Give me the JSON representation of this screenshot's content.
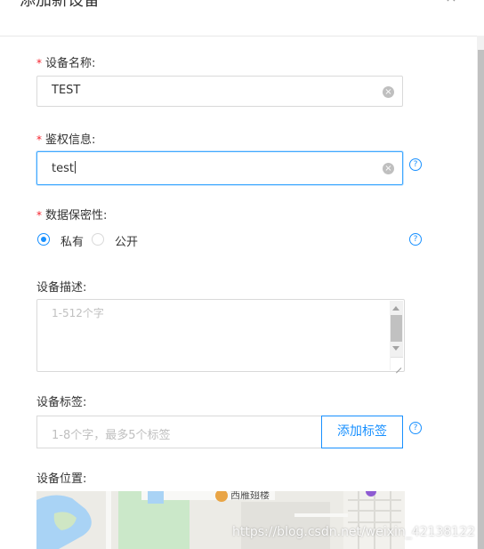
{
  "dialog": {
    "title": "添加新设备",
    "close_glyph": "×"
  },
  "form": {
    "device_name": {
      "required_mark": "*",
      "label": "设备名称:",
      "value": "TEST"
    },
    "auth_info": {
      "required_mark": "*",
      "label": "鉴权信息:",
      "value": "test"
    },
    "data_privacy": {
      "required_mark": "*",
      "label": "数据保密性:",
      "options": [
        {
          "label": "私有",
          "checked": true
        },
        {
          "label": "公开",
          "checked": false
        }
      ]
    },
    "description": {
      "label": "设备描述:",
      "placeholder": "1-512个字"
    },
    "tags": {
      "label": "设备标签:",
      "placeholder": "1-8个字，最多5个标签",
      "add_button": "添加标签"
    },
    "location": {
      "label": "设备位置:",
      "map_place_label": "西雁翅楼"
    }
  },
  "icons": {
    "clear": "×",
    "help": "?"
  },
  "colors": {
    "primary": "#1890ff",
    "required": "#f5222d",
    "placeholder": "#bfbfbf"
  },
  "watermark": "https://blog.csdn.net/weixin_42138122"
}
